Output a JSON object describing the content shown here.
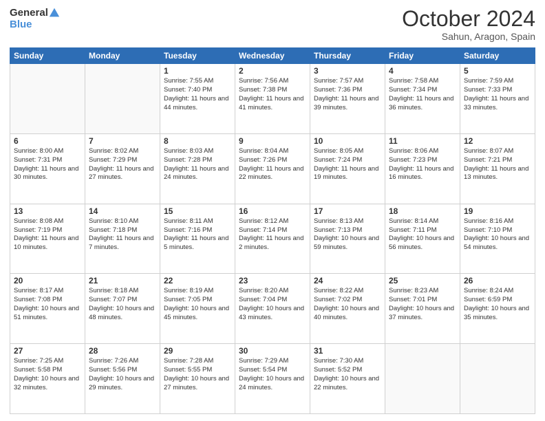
{
  "header": {
    "logo_general": "General",
    "logo_blue": "Blue",
    "month_year": "October 2024",
    "location": "Sahun, Aragon, Spain"
  },
  "days_of_week": [
    "Sunday",
    "Monday",
    "Tuesday",
    "Wednesday",
    "Thursday",
    "Friday",
    "Saturday"
  ],
  "weeks": [
    [
      {
        "day": "",
        "empty": true
      },
      {
        "day": "",
        "empty": true
      },
      {
        "day": "1",
        "sunrise": "Sunrise: 7:55 AM",
        "sunset": "Sunset: 7:40 PM",
        "daylight": "Daylight: 11 hours and 44 minutes."
      },
      {
        "day": "2",
        "sunrise": "Sunrise: 7:56 AM",
        "sunset": "Sunset: 7:38 PM",
        "daylight": "Daylight: 11 hours and 41 minutes."
      },
      {
        "day": "3",
        "sunrise": "Sunrise: 7:57 AM",
        "sunset": "Sunset: 7:36 PM",
        "daylight": "Daylight: 11 hours and 39 minutes."
      },
      {
        "day": "4",
        "sunrise": "Sunrise: 7:58 AM",
        "sunset": "Sunset: 7:34 PM",
        "daylight": "Daylight: 11 hours and 36 minutes."
      },
      {
        "day": "5",
        "sunrise": "Sunrise: 7:59 AM",
        "sunset": "Sunset: 7:33 PM",
        "daylight": "Daylight: 11 hours and 33 minutes."
      }
    ],
    [
      {
        "day": "6",
        "sunrise": "Sunrise: 8:00 AM",
        "sunset": "Sunset: 7:31 PM",
        "daylight": "Daylight: 11 hours and 30 minutes."
      },
      {
        "day": "7",
        "sunrise": "Sunrise: 8:02 AM",
        "sunset": "Sunset: 7:29 PM",
        "daylight": "Daylight: 11 hours and 27 minutes."
      },
      {
        "day": "8",
        "sunrise": "Sunrise: 8:03 AM",
        "sunset": "Sunset: 7:28 PM",
        "daylight": "Daylight: 11 hours and 24 minutes."
      },
      {
        "day": "9",
        "sunrise": "Sunrise: 8:04 AM",
        "sunset": "Sunset: 7:26 PM",
        "daylight": "Daylight: 11 hours and 22 minutes."
      },
      {
        "day": "10",
        "sunrise": "Sunrise: 8:05 AM",
        "sunset": "Sunset: 7:24 PM",
        "daylight": "Daylight: 11 hours and 19 minutes."
      },
      {
        "day": "11",
        "sunrise": "Sunrise: 8:06 AM",
        "sunset": "Sunset: 7:23 PM",
        "daylight": "Daylight: 11 hours and 16 minutes."
      },
      {
        "day": "12",
        "sunrise": "Sunrise: 8:07 AM",
        "sunset": "Sunset: 7:21 PM",
        "daylight": "Daylight: 11 hours and 13 minutes."
      }
    ],
    [
      {
        "day": "13",
        "sunrise": "Sunrise: 8:08 AM",
        "sunset": "Sunset: 7:19 PM",
        "daylight": "Daylight: 11 hours and 10 minutes."
      },
      {
        "day": "14",
        "sunrise": "Sunrise: 8:10 AM",
        "sunset": "Sunset: 7:18 PM",
        "daylight": "Daylight: 11 hours and 7 minutes."
      },
      {
        "day": "15",
        "sunrise": "Sunrise: 8:11 AM",
        "sunset": "Sunset: 7:16 PM",
        "daylight": "Daylight: 11 hours and 5 minutes."
      },
      {
        "day": "16",
        "sunrise": "Sunrise: 8:12 AM",
        "sunset": "Sunset: 7:14 PM",
        "daylight": "Daylight: 11 hours and 2 minutes."
      },
      {
        "day": "17",
        "sunrise": "Sunrise: 8:13 AM",
        "sunset": "Sunset: 7:13 PM",
        "daylight": "Daylight: 10 hours and 59 minutes."
      },
      {
        "day": "18",
        "sunrise": "Sunrise: 8:14 AM",
        "sunset": "Sunset: 7:11 PM",
        "daylight": "Daylight: 10 hours and 56 minutes."
      },
      {
        "day": "19",
        "sunrise": "Sunrise: 8:16 AM",
        "sunset": "Sunset: 7:10 PM",
        "daylight": "Daylight: 10 hours and 54 minutes."
      }
    ],
    [
      {
        "day": "20",
        "sunrise": "Sunrise: 8:17 AM",
        "sunset": "Sunset: 7:08 PM",
        "daylight": "Daylight: 10 hours and 51 minutes."
      },
      {
        "day": "21",
        "sunrise": "Sunrise: 8:18 AM",
        "sunset": "Sunset: 7:07 PM",
        "daylight": "Daylight: 10 hours and 48 minutes."
      },
      {
        "day": "22",
        "sunrise": "Sunrise: 8:19 AM",
        "sunset": "Sunset: 7:05 PM",
        "daylight": "Daylight: 10 hours and 45 minutes."
      },
      {
        "day": "23",
        "sunrise": "Sunrise: 8:20 AM",
        "sunset": "Sunset: 7:04 PM",
        "daylight": "Daylight: 10 hours and 43 minutes."
      },
      {
        "day": "24",
        "sunrise": "Sunrise: 8:22 AM",
        "sunset": "Sunset: 7:02 PM",
        "daylight": "Daylight: 10 hours and 40 minutes."
      },
      {
        "day": "25",
        "sunrise": "Sunrise: 8:23 AM",
        "sunset": "Sunset: 7:01 PM",
        "daylight": "Daylight: 10 hours and 37 minutes."
      },
      {
        "day": "26",
        "sunrise": "Sunrise: 8:24 AM",
        "sunset": "Sunset: 6:59 PM",
        "daylight": "Daylight: 10 hours and 35 minutes."
      }
    ],
    [
      {
        "day": "27",
        "sunrise": "Sunrise: 7:25 AM",
        "sunset": "Sunset: 5:58 PM",
        "daylight": "Daylight: 10 hours and 32 minutes."
      },
      {
        "day": "28",
        "sunrise": "Sunrise: 7:26 AM",
        "sunset": "Sunset: 5:56 PM",
        "daylight": "Daylight: 10 hours and 29 minutes."
      },
      {
        "day": "29",
        "sunrise": "Sunrise: 7:28 AM",
        "sunset": "Sunset: 5:55 PM",
        "daylight": "Daylight: 10 hours and 27 minutes."
      },
      {
        "day": "30",
        "sunrise": "Sunrise: 7:29 AM",
        "sunset": "Sunset: 5:54 PM",
        "daylight": "Daylight: 10 hours and 24 minutes."
      },
      {
        "day": "31",
        "sunrise": "Sunrise: 7:30 AM",
        "sunset": "Sunset: 5:52 PM",
        "daylight": "Daylight: 10 hours and 22 minutes."
      },
      {
        "day": "",
        "empty": true
      },
      {
        "day": "",
        "empty": true
      }
    ]
  ]
}
